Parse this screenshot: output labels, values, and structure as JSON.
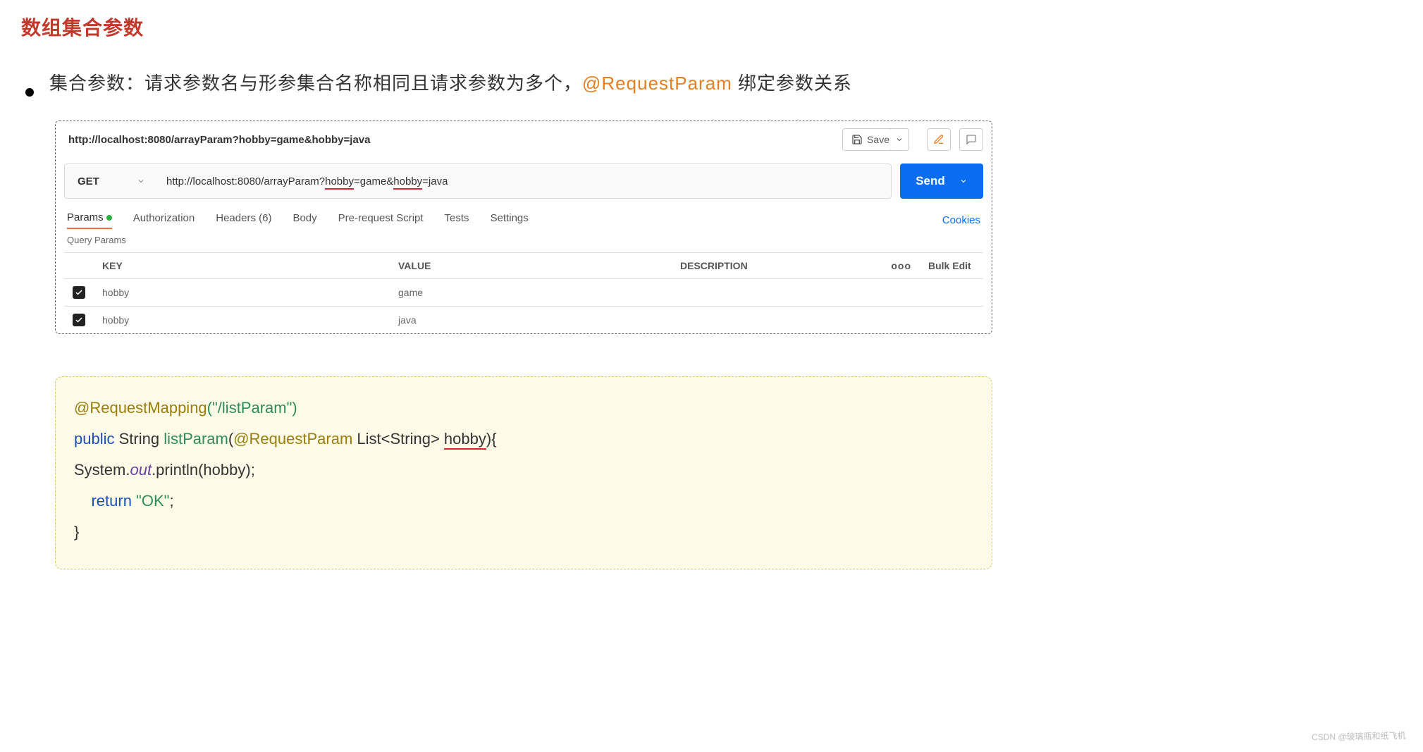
{
  "page": {
    "title": "数组集合参数"
  },
  "bullet": {
    "prefix": "集合参数：请求参数名与形参集合名称相同且请求参数为多个，",
    "highlight": "@RequestParam",
    "suffix": " 绑定参数关系"
  },
  "topbar": {
    "title": "http://localhost:8080/arrayParam?hobby=game&hobby=java",
    "save_label": "Save"
  },
  "request": {
    "method": "GET",
    "url_pre_q": "http://localhost:8080/arrayParam?",
    "p1_key": "hobby",
    "p1_rest": "=game&",
    "p2_key": "hobby",
    "p2_rest": "=java",
    "send_label": "Send"
  },
  "tabs": {
    "params": "Params",
    "auth": "Authorization",
    "headers": "Headers (6)",
    "body": "Body",
    "pre": "Pre-request Script",
    "tests": "Tests",
    "settings": "Settings",
    "cookies": "Cookies"
  },
  "query": {
    "title": "Query Params",
    "h_key": "KEY",
    "h_value": "VALUE",
    "h_desc": "DESCRIPTION",
    "h_more": "ooo",
    "h_bulk": "Bulk Edit",
    "rows": [
      {
        "key": "hobby",
        "value": "game"
      },
      {
        "key": "hobby",
        "value": "java"
      }
    ]
  },
  "code": {
    "anno": "@RequestMapping",
    "anno_arg": "(\"/listParam\")",
    "kw_public": "public",
    "t_string": " String ",
    "fn": "listParam",
    "lparen": "(",
    "anno2": "@RequestParam",
    "gen": " List<String> ",
    "param": "hobby",
    "rparen_brace": "){",
    "l3a": "    System.",
    "l3b": "out",
    "l3c": ".println(hobby);",
    "kw_return": "return",
    "ret_str": " \"OK\"",
    "semi": ";",
    "close": "}"
  },
  "watermark": "CSDN @玻璃瓶和纸飞机"
}
